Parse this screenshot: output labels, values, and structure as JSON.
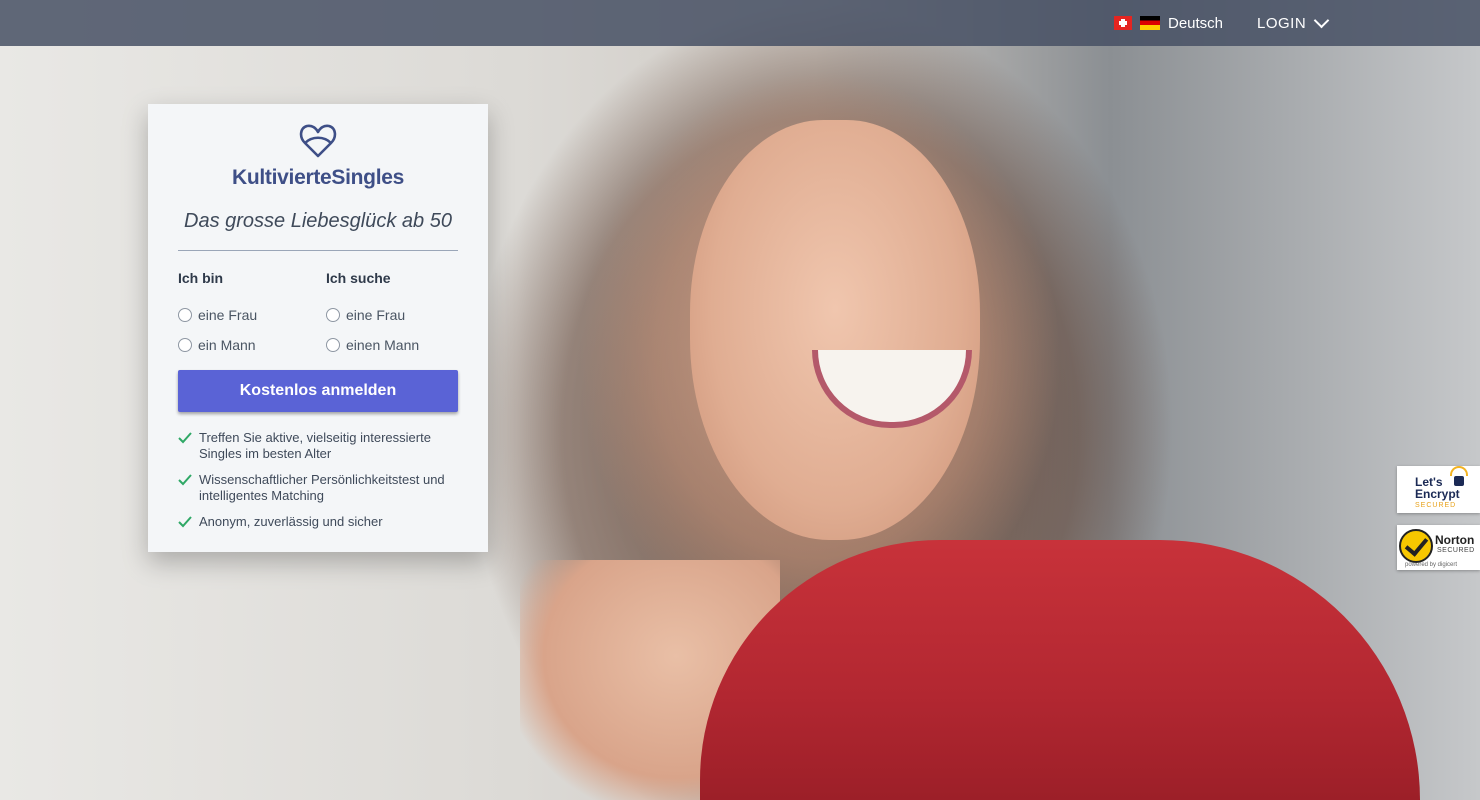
{
  "header": {
    "language_label": "Deutsch",
    "login_label": "LOGIN"
  },
  "card": {
    "brand": "KultivierteSingles",
    "tagline": "Das grosse Liebesglück ab 50",
    "i_am": {
      "heading": "Ich bin",
      "options": [
        "eine Frau",
        "ein Mann"
      ]
    },
    "i_seek": {
      "heading": "Ich suche",
      "options": [
        "eine Frau",
        "einen Mann"
      ]
    },
    "cta_label": "Kostenlos anmelden",
    "features": [
      "Treffen Sie aktive, vielseitig interessierte Singles im besten Alter",
      "Wissenschaftlicher Persönlichkeitstest und intelligentes Matching",
      "Anonym, zuverlässig und sicher"
    ]
  },
  "badges": {
    "letsencrypt": {
      "line1": "Let's",
      "line2": "Encrypt",
      "sub": "SECURED"
    },
    "norton": {
      "title": "Norton",
      "sub": "SECURED",
      "powered": "powered by digicert"
    }
  },
  "colors": {
    "accent": "#5a63d6",
    "brand": "#3e4f87",
    "check": "#2fa866"
  },
  "icons": {
    "logo": "infinity-heart-icon",
    "feature_bullet": "check-icon",
    "login_dropdown": "chevron-down-icon"
  }
}
